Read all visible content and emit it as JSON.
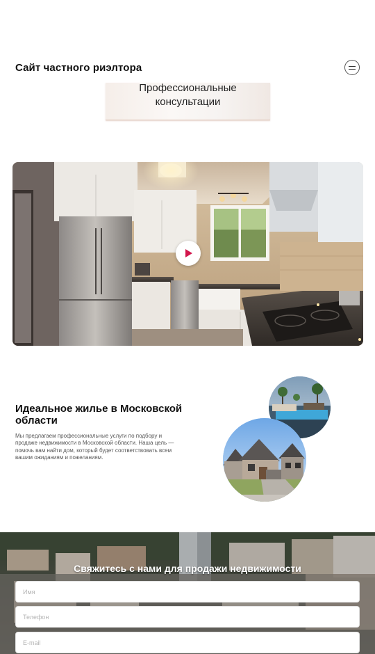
{
  "header": {
    "site_title": "Сайт частного риэлтора",
    "menu_icon": "menu-icon"
  },
  "consult_card": {
    "line1": "Профессиональные",
    "line2": "консультации"
  },
  "video": {
    "play_icon": "play-icon",
    "accent": "#d2164c"
  },
  "ideal": {
    "title": "Идеальное жилье в Московской области",
    "text": "Мы предлагаем профессиональные услуги по подбору и продаже недвижимости в Московской области. Наша цель — помочь вам найти дом, который будет соответствовать всем вашим ожиданиям и пожеланиям."
  },
  "contact": {
    "title": "Свяжитесь с нами для продажи недвижимости",
    "name_placeholder": "Имя",
    "phone_placeholder": "Телефон",
    "email_placeholder": "E-mail"
  }
}
